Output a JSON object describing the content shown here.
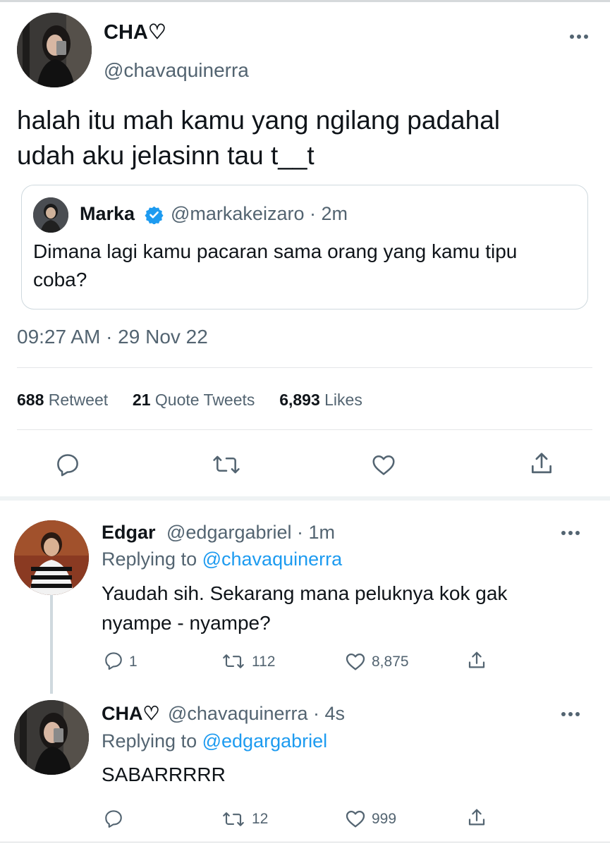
{
  "main_tweet": {
    "display_name": "CHA♡",
    "handle": "@chavaquinerra",
    "text_line1": "halah itu mah kamu yang ngilang padahal",
    "text_line2": "udah aku jelasinn tau t__t",
    "quoted": {
      "display_name": "Marka",
      "handle_time": "@markakeizaro · 2m",
      "text_line1": "Dimana lagi kamu pacaran sama orang yang kamu tipu",
      "text_line2": "coba?"
    },
    "timestamp": "09:27 AM · 29 Nov 22",
    "stats": {
      "retweets": "688",
      "retweets_label": "Retweet",
      "quotes": "21",
      "quotes_label": "Quote Tweets",
      "likes": "6,893",
      "likes_label": "Likes"
    }
  },
  "replies": [
    {
      "display_name": "Edgar",
      "handle_time": "@edgargabriel · 1m",
      "replying_prefix": "Replying to",
      "replying_to": "@chavaquinerra",
      "text_line1": "Yaudah sih. Sekarang mana peluknya kok gak",
      "text_line2": "nyampe - nyampe?",
      "replies_count": "1",
      "retweets_count": "112",
      "likes_count": "8,875"
    },
    {
      "display_name": "CHA♡",
      "handle_time": "@chavaquinerra · 4s",
      "replying_prefix": "Replying to",
      "replying_to": "@edgargabriel",
      "text_line1": "SABARRRRR",
      "replies_count": "",
      "retweets_count": "12",
      "likes_count": "999"
    }
  ],
  "colors": {
    "verified_badge": "#1d9bf0",
    "link": "#1d9bf0",
    "secondary_text": "#536471",
    "icon": "#536471"
  },
  "icons": [
    "more-icon",
    "reply-icon",
    "retweet-icon",
    "like-icon",
    "share-icon",
    "verified-badge-icon"
  ]
}
